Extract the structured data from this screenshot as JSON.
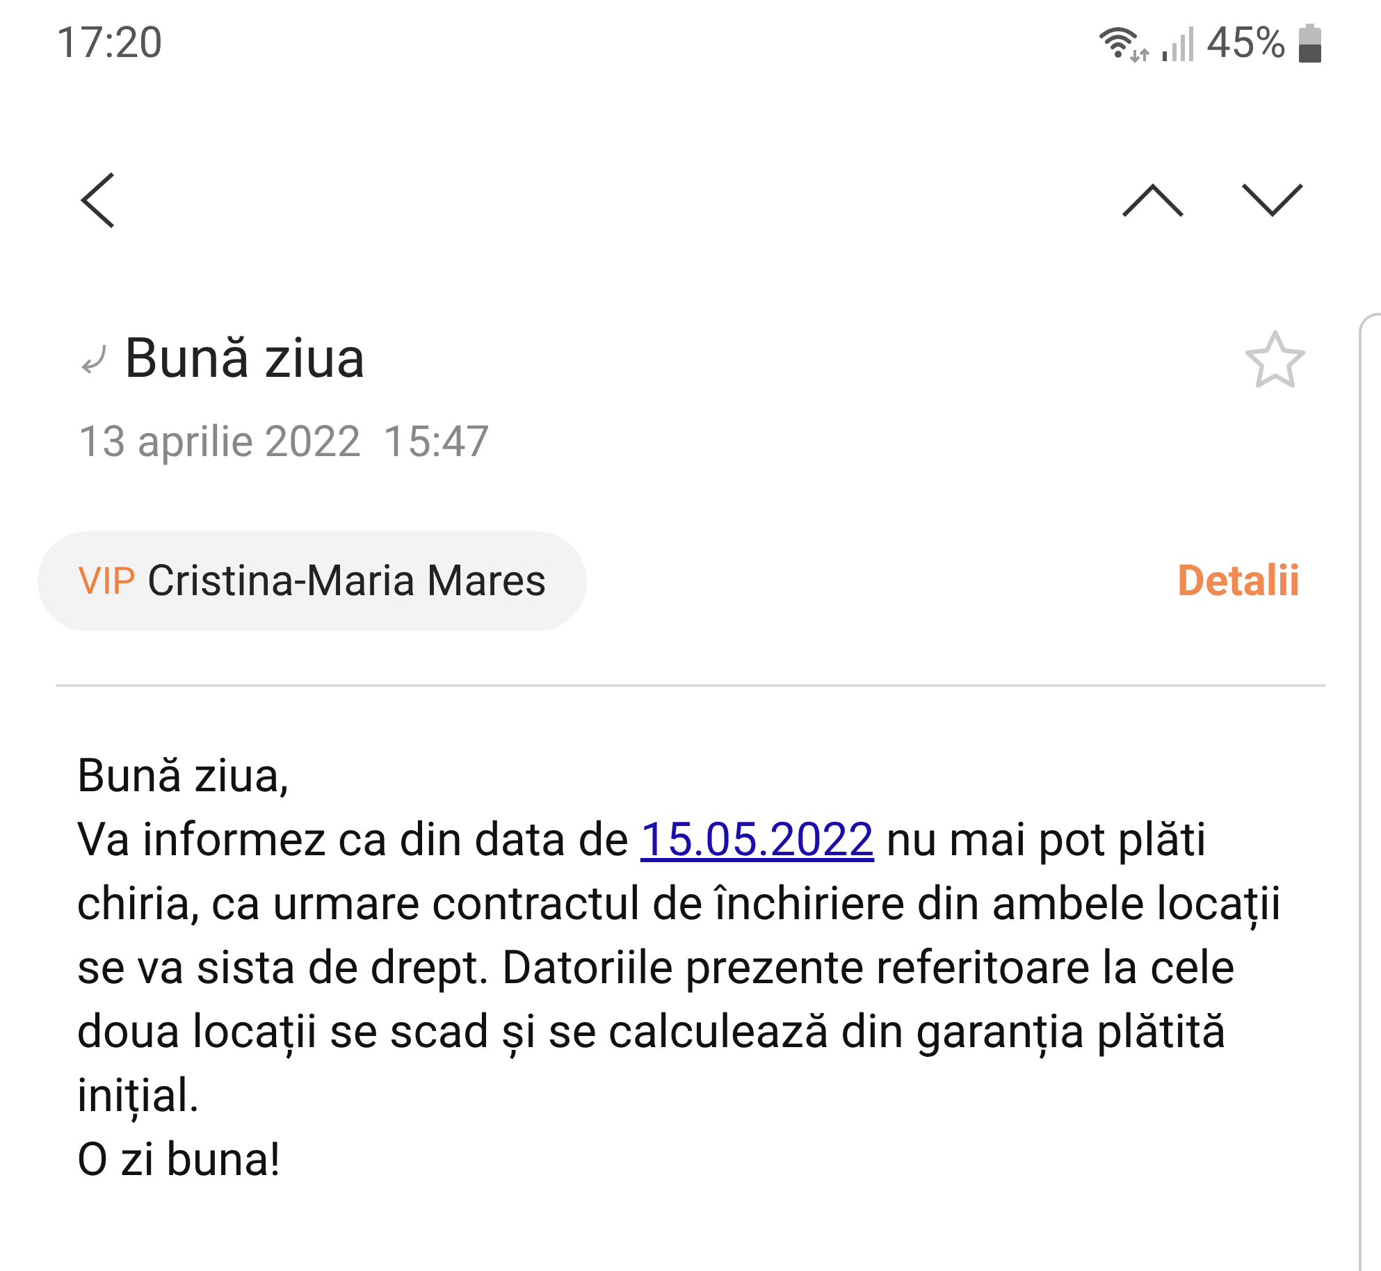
{
  "status_bar": {
    "time": "17:20",
    "battery": "45%"
  },
  "email": {
    "subject": "Bună ziua",
    "starred": false,
    "date": "13 aprilie 2022  15:47",
    "sender_badge": "VIP",
    "sender": "Cristina-Maria Mares",
    "details_link": "Detalii"
  },
  "body": {
    "greeting": "Bună ziua,",
    "text_before_link": "Va informez ca din data de ",
    "link": "15.05.2022",
    "text_after_link": " nu mai pot plăti chiria, ca urmare contractul de închiriere din ambele locații se va sista de drept. Datoriile prezente referitoare la cele doua locații se scad și se calculează din garanția plătită inițial.",
    "closing": "O zi buna!"
  }
}
